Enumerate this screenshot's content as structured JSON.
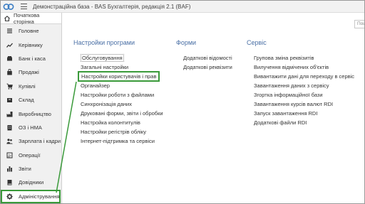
{
  "app": {
    "title": "Демонстраційна база - BAS Бухгалтерія, редакція 2.1 (BAF)",
    "home_label": "Початкова сторінка",
    "search_placeholder": "Пошук"
  },
  "sidebar": {
    "items": [
      {
        "label": "Головне",
        "icon": "list-icon",
        "active": false
      },
      {
        "label": "Керівнику",
        "icon": "trend-icon",
        "active": false
      },
      {
        "label": "Банк і каса",
        "icon": "bank-icon",
        "active": false
      },
      {
        "label": "Продажі",
        "icon": "bag-icon",
        "active": false
      },
      {
        "label": "Купівлі",
        "icon": "cart-icon",
        "active": false
      },
      {
        "label": "Склад",
        "icon": "box-icon",
        "active": false
      },
      {
        "label": "Виробництво",
        "icon": "factory-icon",
        "active": false
      },
      {
        "label": "ОЗ і НМА",
        "icon": "building-icon",
        "active": false
      },
      {
        "label": "Зарплата і кадри",
        "icon": "people-icon",
        "active": false
      },
      {
        "label": "Операції",
        "icon": "dt-kt-icon",
        "active": false
      },
      {
        "label": "Звіти",
        "icon": "bar-chart-icon",
        "active": false
      },
      {
        "label": "Довідники",
        "icon": "book-icon",
        "active": false
      },
      {
        "label": "Адміністрування",
        "icon": "gear-icon",
        "active": true
      }
    ]
  },
  "sections": {
    "settings": {
      "title": "Настройки програми",
      "links": [
        "Обслуговування",
        "Загальні настройки",
        "Настройки користувачів і прав",
        "Органайзер",
        "Настройки роботи з файлами",
        "Синхронізація даних",
        "Друковані форми, звіти і обробки",
        "Настройка колонтитулів",
        "Настройки регістрів обліку",
        "Інтернет-підтримка та сервіси"
      ]
    },
    "forms": {
      "title": "Форми",
      "links": [
        "Додаткові відомості",
        "Додаткові реквізити"
      ]
    },
    "service": {
      "title": "Сервіс",
      "links": [
        "Групова зміна реквізитів",
        "Вилучення відмічених об'єктів",
        "Вивантажити дані для переходу в сервіс",
        "Завантаження даних з сервісу",
        "Згортка інформаційної бази",
        "Завантаження курсів валют RDI",
        "Запуск завантаження RDI",
        "Додаткові файли RDI"
      ]
    }
  },
  "colors": {
    "accent": "#3a9a3a",
    "section_title": "#4a6fa5",
    "logo": "#3b7dc4"
  }
}
